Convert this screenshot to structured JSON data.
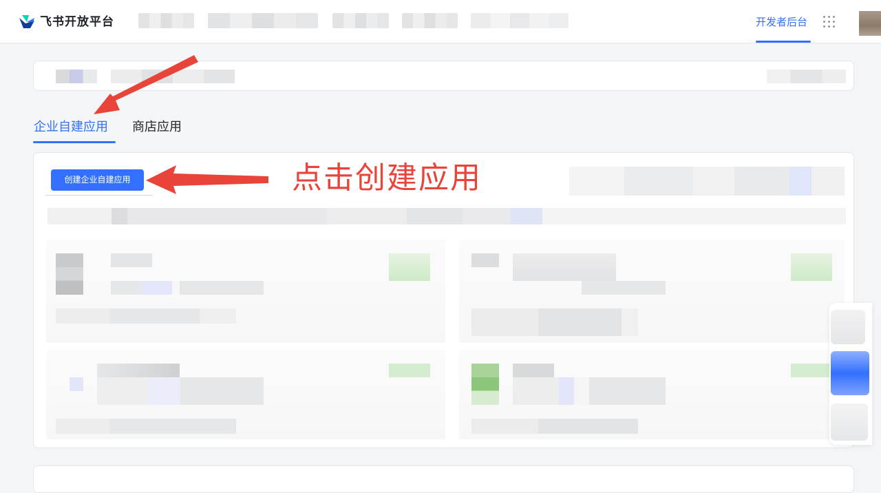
{
  "header": {
    "brand": "飞书开放平台",
    "dev_console": "开发者后台",
    "logo_icon": "feishu-logo-icon",
    "apps_icon": "grid-icon"
  },
  "tabs": {
    "enterprise": "企业自建应用",
    "store": "商店应用"
  },
  "main": {
    "create_button": "创建企业自建应用"
  },
  "annotation": {
    "text": "点击创建应用",
    "color": "#e8443a"
  },
  "colors": {
    "accent": "#3370ff",
    "background": "#f4f5f7"
  }
}
